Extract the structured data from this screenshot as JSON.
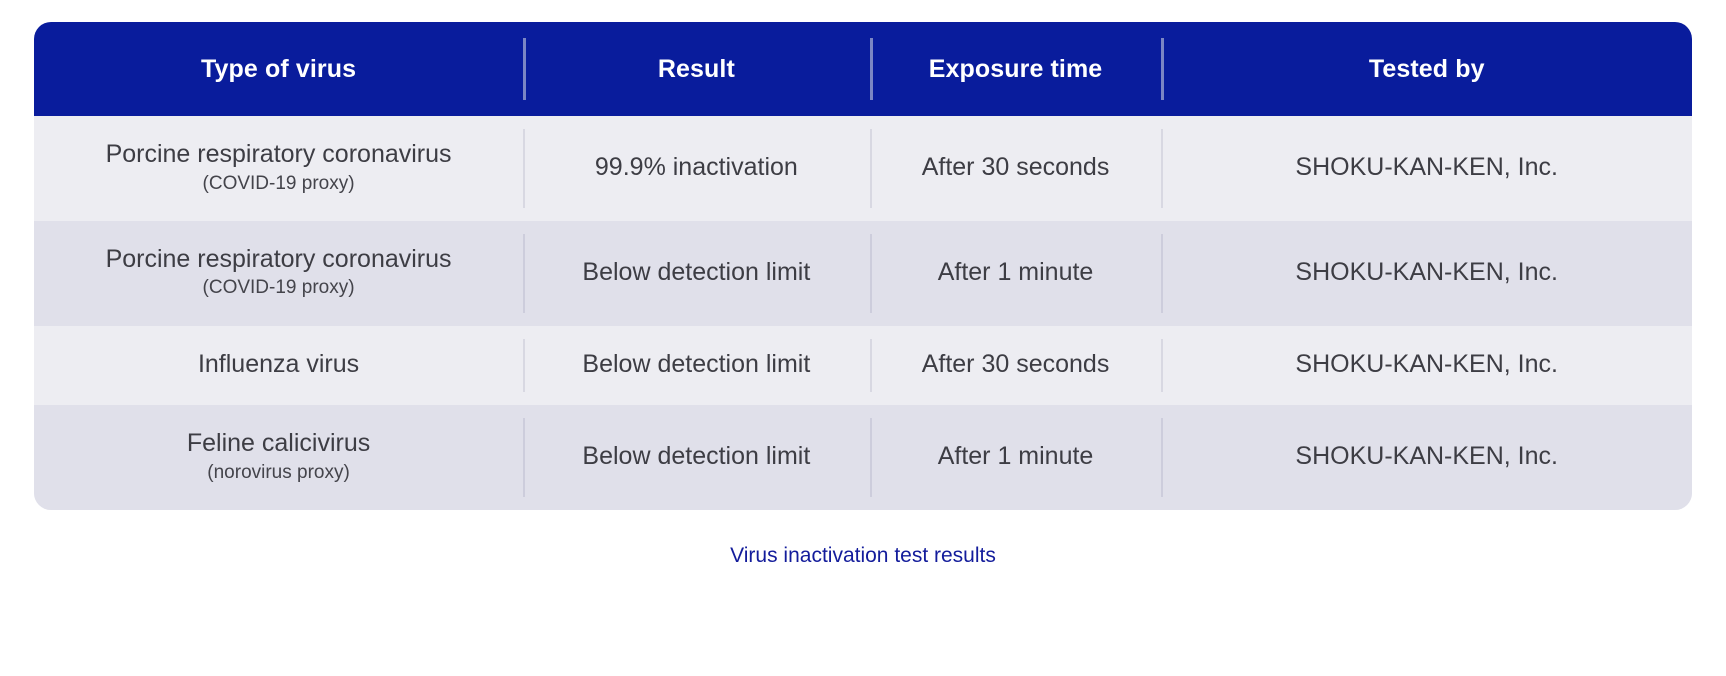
{
  "table": {
    "columns": [
      {
        "key": "virus",
        "label": "Type of virus"
      },
      {
        "key": "result",
        "label": "Result"
      },
      {
        "key": "exposure",
        "label": "Exposure time"
      },
      {
        "key": "tester",
        "label": "Tested by"
      }
    ],
    "rows": [
      {
        "virus": "Porcine respiratory coronavirus",
        "virus_sub": "(COVID-19 proxy)",
        "result": "99.9% inactivation",
        "exposure": "After 30 seconds",
        "tester": "SHOKU-KAN-KEN, Inc."
      },
      {
        "virus": "Porcine respiratory coronavirus",
        "virus_sub": "(COVID-19 proxy)",
        "result": "Below detection limit",
        "exposure": "After 1 minute",
        "tester": "SHOKU-KAN-KEN, Inc."
      },
      {
        "virus": "Influenza virus",
        "virus_sub": "",
        "result": "Below detection limit",
        "exposure": "After 30 seconds",
        "tester": "SHOKU-KAN-KEN, Inc."
      },
      {
        "virus": "Feline calicivirus",
        "virus_sub": "(norovirus proxy)",
        "result": "Below detection limit",
        "exposure": "After 1 minute",
        "tester": "SHOKU-KAN-KEN, Inc."
      }
    ]
  },
  "caption": "Virus inactivation test results",
  "colors": {
    "header_background": "#091C9C",
    "row_odd_background": "#EDEDF2",
    "row_even_background": "#E0E0EA",
    "header_text": "#FFFFFF",
    "body_text": "#3D3D44",
    "caption_text": "#131C9B",
    "divider": "#D8D8E2"
  }
}
